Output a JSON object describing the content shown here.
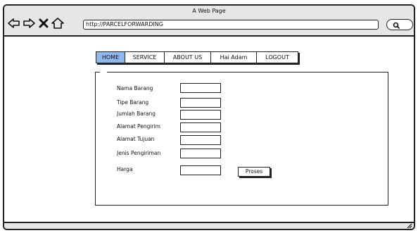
{
  "browser": {
    "title": "A Web Page",
    "url": "http://PARCELFORWARDING",
    "icons": [
      "back-arrow-icon",
      "forward-arrow-icon",
      "close-icon",
      "home-icon",
      "search-icon"
    ]
  },
  "menu": {
    "items": [
      {
        "label": "HOME",
        "active": true
      },
      {
        "label": "SERVICE"
      },
      {
        "label": "ABOUT US"
      },
      {
        "label": "Hai Adam"
      },
      {
        "label": "LOGOUT"
      }
    ],
    "active_color": "#8fb8ee"
  },
  "form": {
    "fields": [
      {
        "label": "Nama Barang",
        "value": ""
      },
      {
        "label": "Tipe Barang",
        "value": ""
      },
      {
        "label": "Jumlah Barang",
        "value": ""
      },
      {
        "label": "Alamat Pengirim",
        "value": ""
      },
      {
        "label": "Alamat Tujuan",
        "value": ""
      },
      {
        "label": "Jenis Pengiriman",
        "value": ""
      },
      {
        "label": "Harga",
        "value": ""
      }
    ],
    "submit_label": "Proses"
  }
}
